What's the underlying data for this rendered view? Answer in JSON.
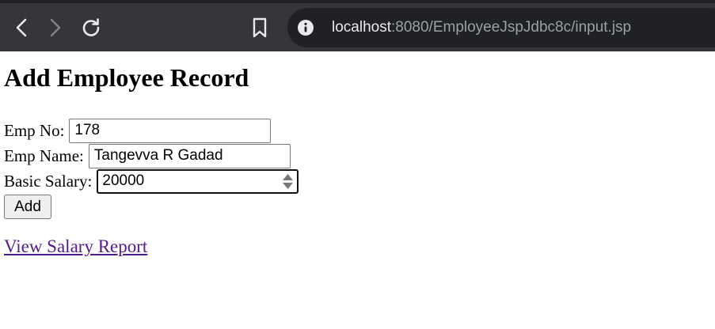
{
  "browser": {
    "url_host": "localhost",
    "url_path": ":8080/EmployeeJspJdbc8c/input.jsp",
    "icons": {
      "back": "back-arrow-icon",
      "forward": "forward-arrow-icon",
      "reload": "reload-icon",
      "bookmark": "bookmark-icon",
      "site_info": "info-icon"
    }
  },
  "page": {
    "title": "Add Employee Record",
    "fields": {
      "emp_no": {
        "label": "Emp No:",
        "value": "178"
      },
      "emp_name": {
        "label": "Emp Name:",
        "value": "Tangevva R Gadad"
      },
      "basic_salary": {
        "label": "Basic Salary:",
        "value": "20000"
      }
    },
    "add_button": "Add",
    "report_link": "View Salary Report",
    "colors": {
      "visited_link": "#551a8b",
      "chrome_bg": "#35363a",
      "omnibox_bg": "#202124"
    }
  }
}
